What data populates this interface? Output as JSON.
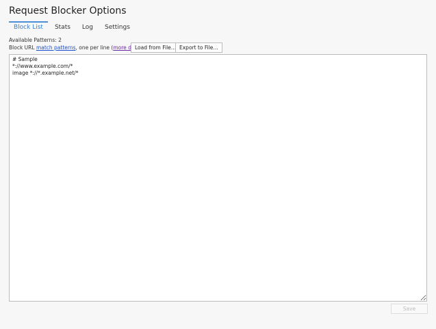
{
  "title": "Request Blocker Options",
  "tabs": [
    "Block List",
    "Stats",
    "Log",
    "Settings"
  ],
  "available_label": "Available Patterns: 2",
  "line": {
    "prefix": "Block URL ",
    "link1": "match patterns",
    "middle": ", one per line (",
    "link2": "more detail",
    "suffix": ")"
  },
  "buttons": {
    "load": "Load from File…",
    "export": "Export to File…",
    "save": "Save"
  },
  "patterns": "# Sample\n*://www.example.com/*\nimage *://*.example.net/*"
}
